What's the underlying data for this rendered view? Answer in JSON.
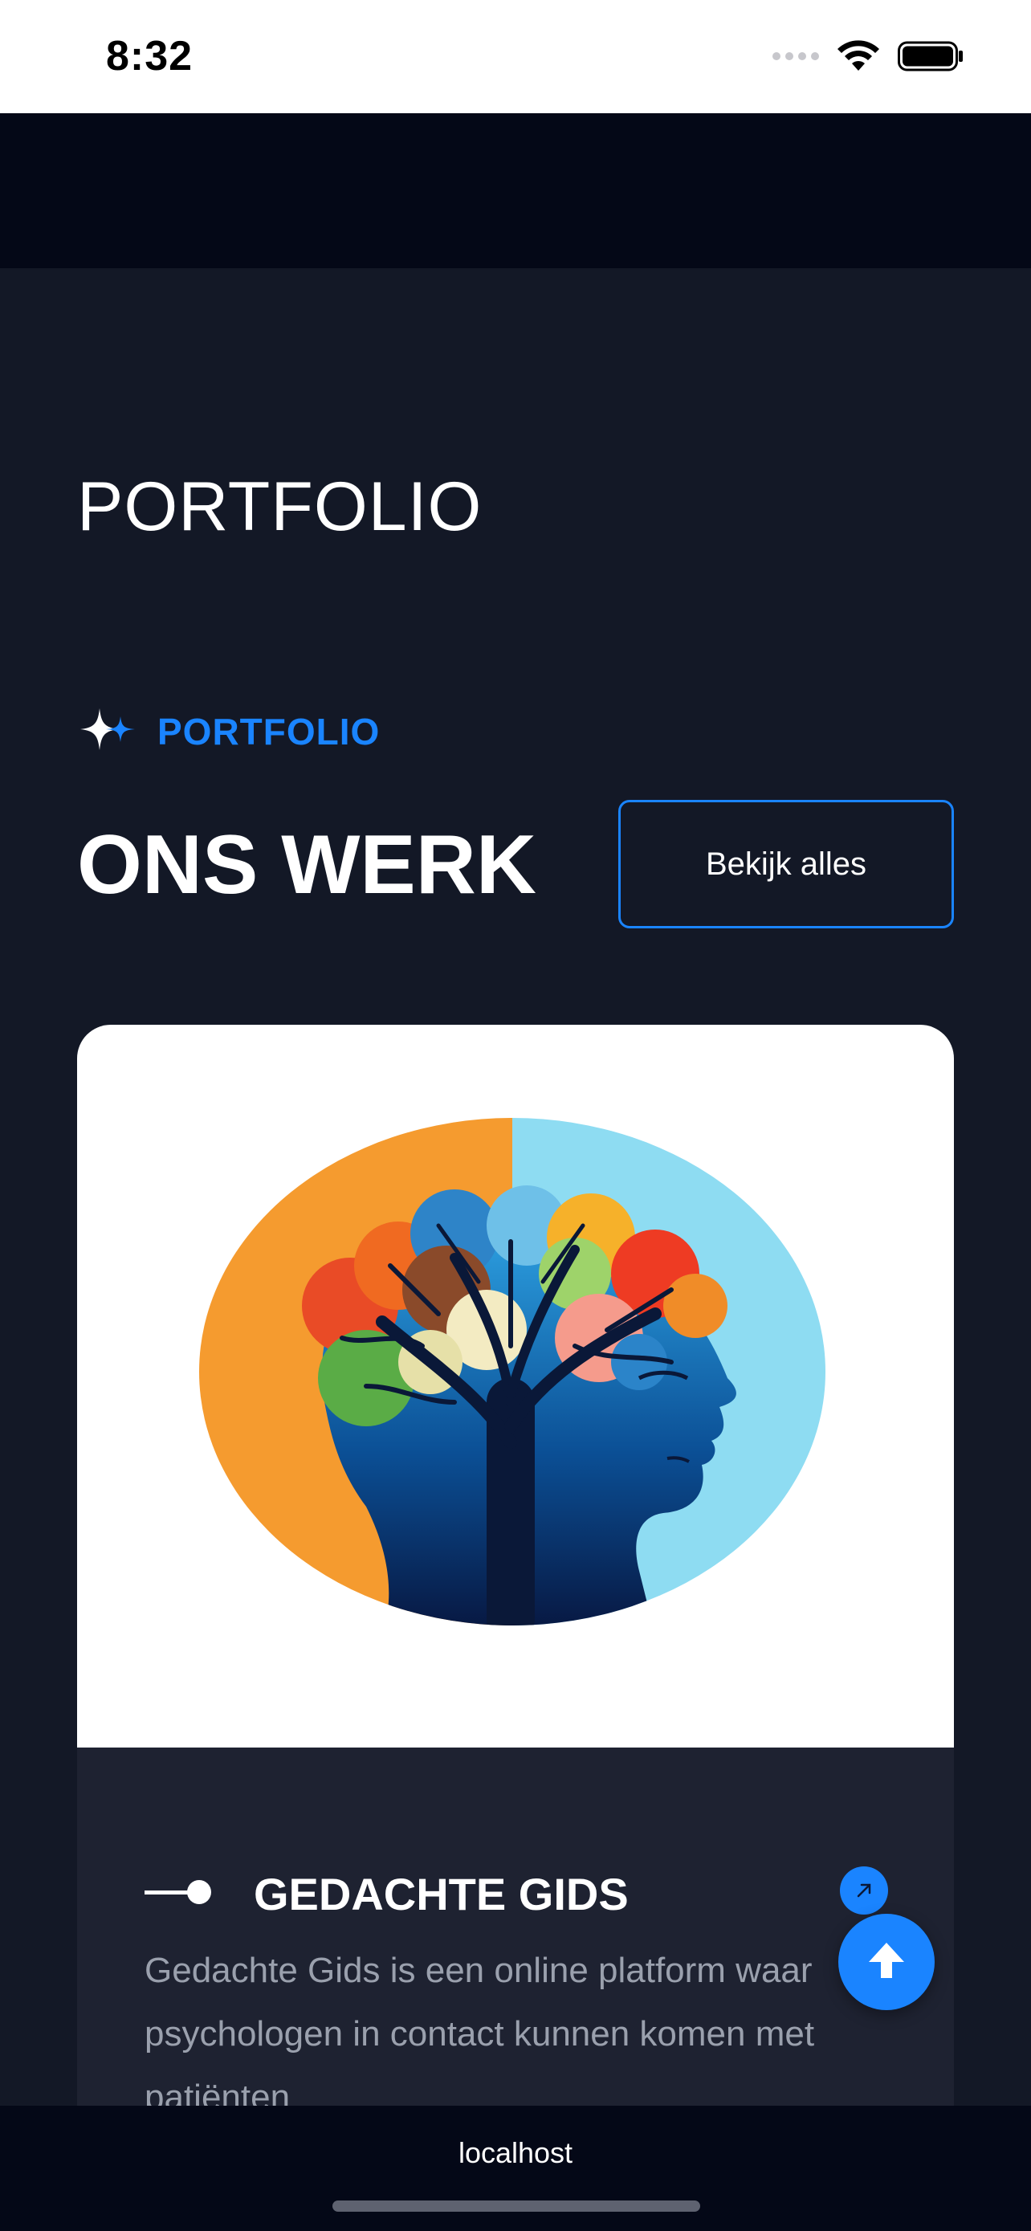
{
  "status_bar": {
    "time": "8:32"
  },
  "page": {
    "title": "PORTFOLIO"
  },
  "section": {
    "eyebrow": "PORTFOLIO",
    "heading": "ONS WERK",
    "view_all_label": "Bekijk alles"
  },
  "card": {
    "title": "GEDACHTE GIDS",
    "description": "Gedachte Gids is een online platform waar psychologen in contact kunnen komen met patiënten"
  },
  "browser": {
    "url": "localhost"
  },
  "colors": {
    "accent": "#1a84ff",
    "background": "#131826",
    "card": "#1e2231"
  },
  "icons": [
    "sparkle-icon",
    "arrow-up-right-icon",
    "arrow-up-icon",
    "wifi-icon",
    "battery-icon",
    "signal-icon"
  ]
}
